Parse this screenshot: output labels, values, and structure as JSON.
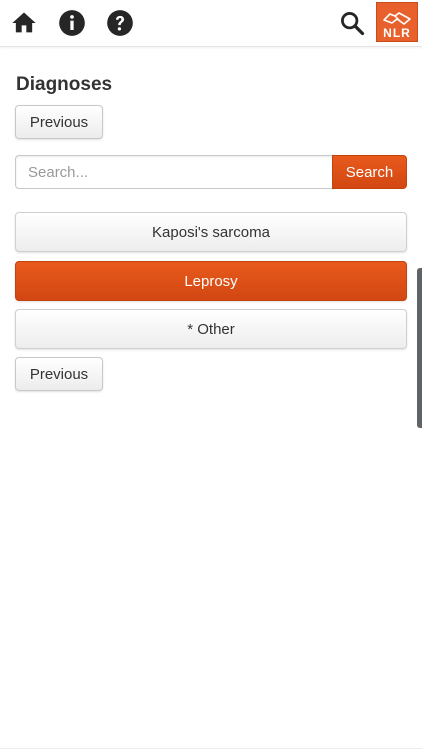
{
  "header": {
    "logo_text": "NLR",
    "icons": [
      "home-icon",
      "info-icon",
      "help-icon",
      "search-icon"
    ],
    "accent_color": "#e8612c"
  },
  "main": {
    "title": "Diagnoses",
    "previous_label": "Previous",
    "search": {
      "placeholder": "Search...",
      "value": "",
      "button_label": "Search"
    },
    "options": [
      {
        "label": "Kaposi's sarcoma",
        "selected": false
      },
      {
        "label": "Leprosy",
        "selected": true
      },
      {
        "label": "* Other",
        "selected": false
      }
    ]
  },
  "colors": {
    "primary": "#d84e14",
    "button_text": "#333333"
  }
}
